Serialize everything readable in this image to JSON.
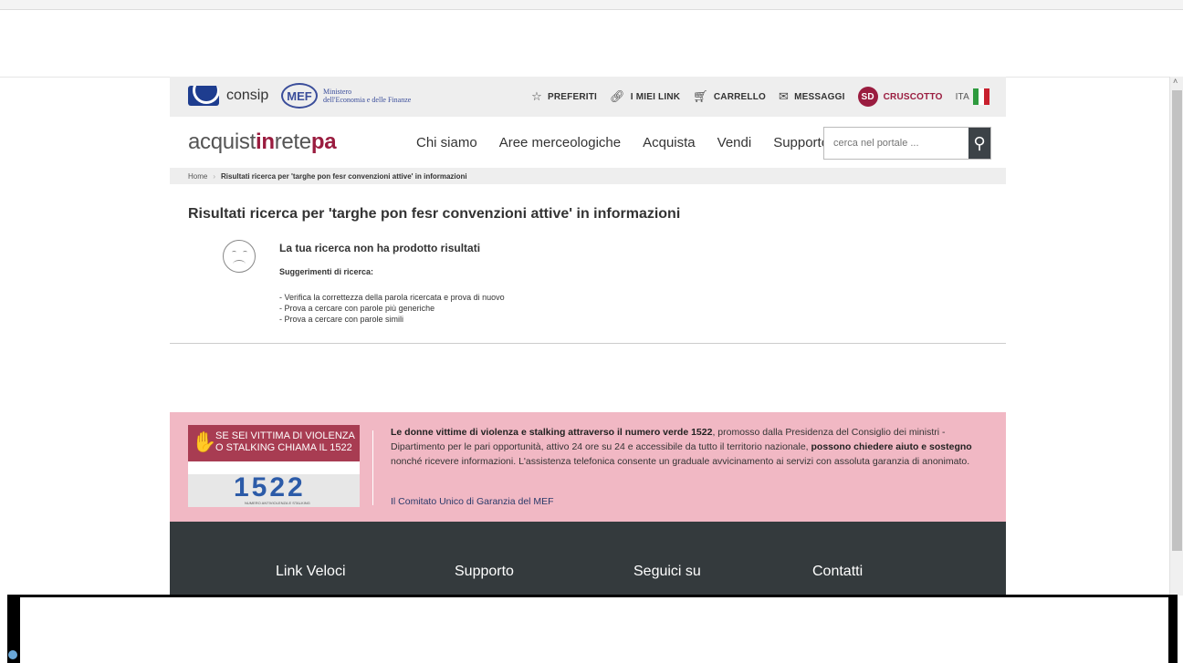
{
  "header": {
    "consip_label": "consip",
    "mef_label": "MEF",
    "mef_text_line1": "Ministero",
    "mef_text_line2": "dell'Economia e delle Finanze",
    "utility": {
      "preferiti": "PREFERITI",
      "miei_link": "I MIEI LINK",
      "carrello": "CARRELLO",
      "messaggi": "MESSAGGI",
      "avatar_initials": "SD",
      "cruscotto": "CRUSCOTTO",
      "lang": "ITA"
    },
    "brand_part1": "acquist",
    "brand_part2": "in",
    "brand_part3": "rete",
    "brand_part4": "pa",
    "nav": {
      "chi_siamo": "Chi siamo",
      "aree": "Aree merceologiche",
      "acquista": "Acquista",
      "vendi": "Vendi",
      "supporto": "Supporto"
    },
    "search_placeholder": "cerca nel portale ..."
  },
  "breadcrumb": {
    "home": "Home",
    "current": "Risultati ricerca per 'targhe pon fesr convenzioni attive' in informazioni"
  },
  "results": {
    "title": "Risultati ricerca per 'targhe pon fesr convenzioni attive' in informazioni",
    "no_result": "La tua ricerca non ha prodotto risultati",
    "suggest_title": "Suggerimenti di ricerca:",
    "suggestions": [
      "- Verifica la correttezza della parola ricercata e prova di nuovo",
      "- Prova a cercare con parole più generiche",
      "- Prova a cercare con parole simili"
    ]
  },
  "violence_banner": {
    "box_line1": "SE SEI VITTIMA DI VIOLENZA",
    "box_line2": "O STALKING CHIAMA IL 1522",
    "box_number": "1522",
    "box_sub": "NUMERO ANTIVIOLENZA E STALKING",
    "text_bold1": "Le donne vittime di violenza e stalking attraverso il numero verde 1522",
    "text_part2": ", promosso dalla Presidenza del Consiglio dei ministri - Dipartimento per le pari opportunità, attivo 24 ore su 24 e accessibile da tutto il territorio nazionale, ",
    "text_bold2": "possono chiedere aiuto e sostegno",
    "text_part3": " nonché ricevere informazioni. L'assistenza telefonica consente un graduale avvicinamento ai servizi con assoluta garanzia di anonimato.",
    "link": "Il Comitato Unico di Garanzia del MEF"
  },
  "footer": {
    "col1": "Link Veloci",
    "col2": "Supporto",
    "col3": "Seguici su",
    "col4": "Contatti"
  },
  "colors": {
    "brand_accent": "#9a1c3f",
    "banner_pink": "#f1b8c4",
    "footer_dark": "#343a3d"
  }
}
